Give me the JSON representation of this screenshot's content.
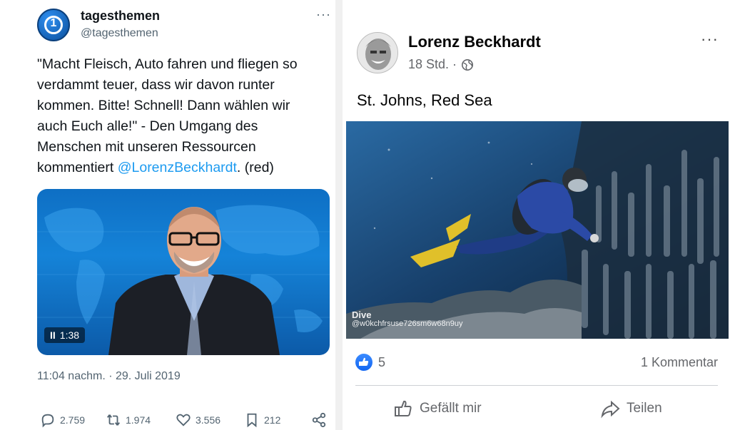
{
  "tweet": {
    "author_name": "tagesthemen",
    "author_handle": "@tagesthemen",
    "more": "···",
    "text_before_mention": "\"Macht Fleisch, Auto fahren und fliegen so verdammt teuer, dass wir davon runter kommen. Bitte! Schnell! Dann wählen wir auch Euch alle!\" - Den Umgang des Menschen mit unseren Ressourcen kommentiert ",
    "mention": "@LorenzBeckhardt",
    "text_after_mention": ". (red)",
    "video_time": "1:38",
    "video_pause_glyph": "II",
    "timestamp": "11:04 nachm. · 29. Juli 2019",
    "replies": "2.759",
    "retweets": "1.974",
    "likes": "3.556",
    "bookmarks": "212",
    "avatar_glyph": "1"
  },
  "facebook": {
    "author_name": "Lorenz Beckhardt",
    "time": "18 Std. ·",
    "more": "···",
    "text": "St. Johns, Red Sea",
    "photo_watermark_brand": "Dive",
    "photo_watermark_handle": "@w0kchfrsuse726sm6w68n9uy",
    "like_count": "5",
    "comments": "1 Kommentar",
    "like_button": "Gefällt mir",
    "share_button": "Teilen"
  },
  "colors": {
    "twitter_blue": "#1d9bf0",
    "facebook_blue": "#1266f1",
    "tagesthemen_blue": "#0b4f9c"
  }
}
